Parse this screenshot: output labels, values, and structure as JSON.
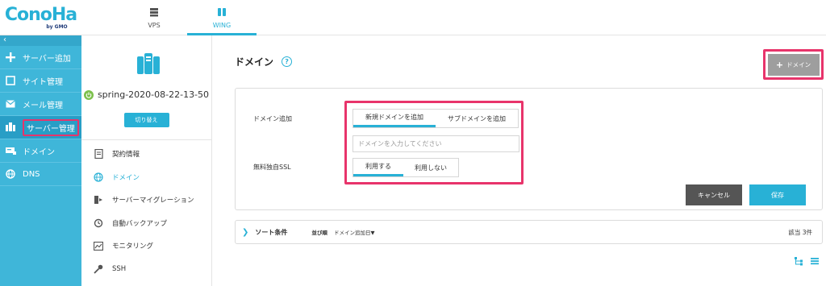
{
  "logo": {
    "main": "ConoHa",
    "sub": "by GMO"
  },
  "top_tabs": [
    {
      "label": "VPS",
      "icon": "server-icon"
    },
    {
      "label": "WING",
      "icon": "wing-server-icon"
    }
  ],
  "sidebar": {
    "collapse": "‹",
    "items": [
      {
        "label": "サーバー追加",
        "icon": "plus-icon"
      },
      {
        "label": "サイト管理",
        "icon": "window-icon"
      },
      {
        "label": "メール管理",
        "icon": "mail-icon"
      },
      {
        "label": "サーバー管理",
        "icon": "server-manage-icon"
      },
      {
        "label": "ドメイン",
        "icon": "domain-icon"
      },
      {
        "label": "DNS",
        "icon": "globe-icon"
      }
    ]
  },
  "server": {
    "name": "spring-2020-08-22-13-50",
    "switch_label": "切り替え"
  },
  "subnav": {
    "items": [
      {
        "label": "契約情報",
        "icon": "contract-icon"
      },
      {
        "label": "ドメイン",
        "icon": "globe-icon"
      },
      {
        "label": "サーバーマイグレーション",
        "icon": "migration-icon"
      },
      {
        "label": "自動バックアップ",
        "icon": "backup-icon"
      },
      {
        "label": "モニタリング",
        "icon": "monitor-icon"
      },
      {
        "label": "SSH",
        "icon": "key-icon"
      }
    ]
  },
  "main": {
    "title": "ドメイン",
    "help": "?",
    "add_domain_label": "ドメイン",
    "add_domain_plus": "+",
    "form": {
      "domain_add_label": "ドメイン追加",
      "new_domain_tab": "新規ドメインを追加",
      "sub_domain_tab": "サブドメインを追加",
      "domain_input_placeholder": "ドメインを入力してください",
      "ssl_label": "無料独自SSL",
      "ssl_use": "利用する",
      "ssl_not_use": "利用しない",
      "cancel": "キャンセル",
      "save": "保存"
    },
    "sort": {
      "title": "ソート条件",
      "order_label": "並び順",
      "order_value": "ドメイン追加日▼",
      "count": "該当 3件"
    }
  },
  "colors": {
    "accent": "#28b1d6",
    "sidebar": "#3fb6d9",
    "highlight": "#e8346b"
  }
}
